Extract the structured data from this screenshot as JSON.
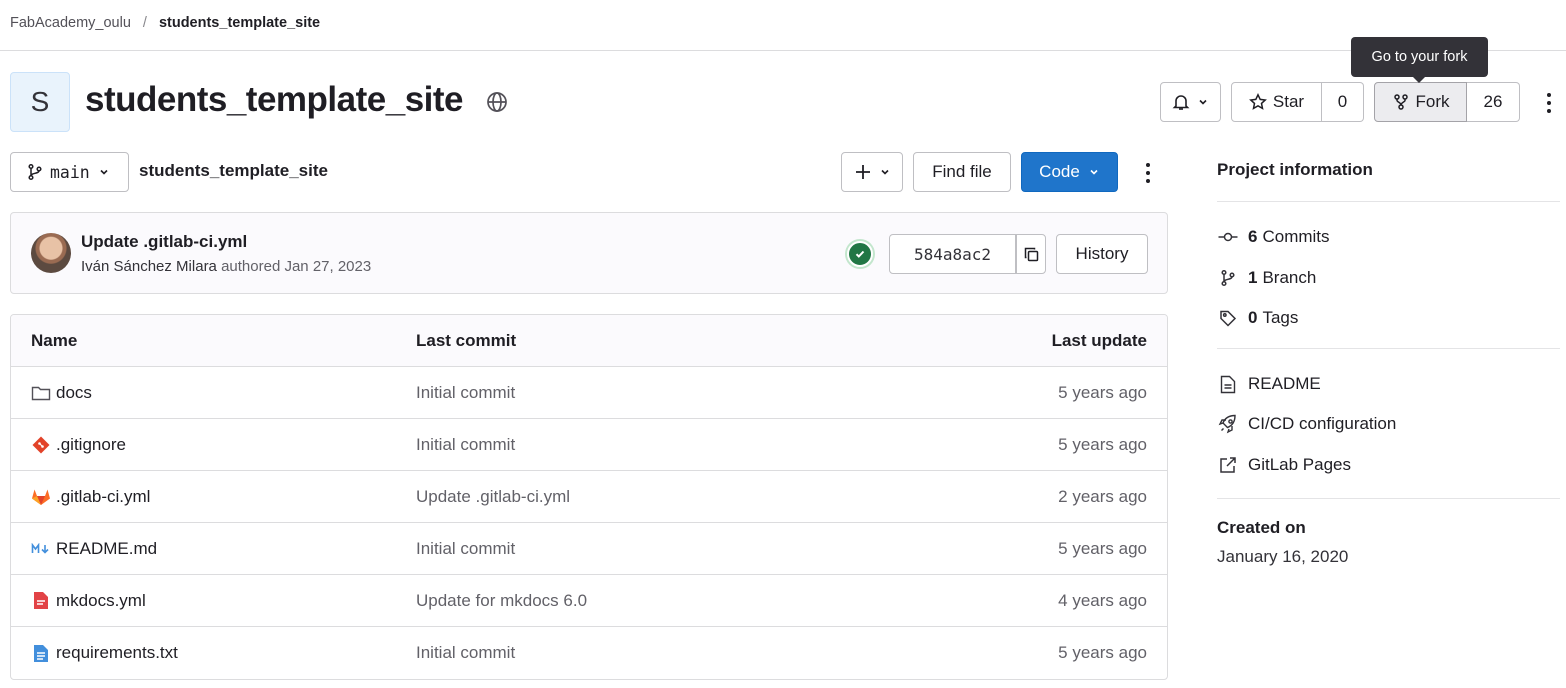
{
  "breadcrumb": {
    "group": "FabAcademy_oulu",
    "separator": "/",
    "current": "students_template_site"
  },
  "project": {
    "avatar_letter": "S",
    "title": "students_template_site",
    "visibility_icon": "globe-icon"
  },
  "actions": {
    "notifications_icon": "bell-icon",
    "star_label": "Star",
    "star_count": "0",
    "fork_label": "Fork",
    "fork_count": "26",
    "fork_tooltip": "Go to your fork"
  },
  "repo_toolbar": {
    "branch": "main",
    "path": "students_template_site",
    "add_icon": "plus-icon",
    "find_file_label": "Find file",
    "code_label": "Code"
  },
  "last_commit": {
    "title": "Update .gitlab-ci.yml",
    "author": "Iván Sánchez Milara",
    "authored_text": "authored Jan 27, 2023",
    "sha": "584a8ac2",
    "history_label": "History",
    "pipeline_status": "passed"
  },
  "file_table": {
    "headers": {
      "name": "Name",
      "last_commit": "Last commit",
      "last_update": "Last update"
    },
    "rows": [
      {
        "icon": "folder-icon",
        "name": "docs",
        "commit": "Initial commit",
        "updated": "5 years ago"
      },
      {
        "icon": "git-icon",
        "name": ".gitignore",
        "commit": "Initial commit",
        "updated": "5 years ago"
      },
      {
        "icon": "gitlab-icon",
        "name": ".gitlab-ci.yml",
        "commit": "Update .gitlab-ci.yml",
        "updated": "2 years ago"
      },
      {
        "icon": "markdown-icon",
        "name": "README.md",
        "commit": "Initial commit",
        "updated": "5 years ago"
      },
      {
        "icon": "yaml-file-icon",
        "name": "mkdocs.yml",
        "commit": "Update for mkdocs 6.0",
        "updated": "4 years ago"
      },
      {
        "icon": "text-file-icon",
        "name": "requirements.txt",
        "commit": "Initial commit",
        "updated": "5 years ago"
      }
    ]
  },
  "sidebar": {
    "title": "Project information",
    "stats": [
      {
        "count": "6",
        "label": "Commits"
      },
      {
        "count": "1",
        "label": "Branch"
      },
      {
        "count": "0",
        "label": "Tags"
      }
    ],
    "links": [
      {
        "label": "README"
      },
      {
        "label": "CI/CD configuration"
      },
      {
        "label": "GitLab Pages"
      }
    ],
    "created_heading": "Created on",
    "created_date": "January 16, 2020"
  },
  "colors": {
    "primary": "#1f75cb",
    "success": "#217645",
    "text": "#1f1e24",
    "muted": "#626168",
    "border": "#dcdcde"
  }
}
